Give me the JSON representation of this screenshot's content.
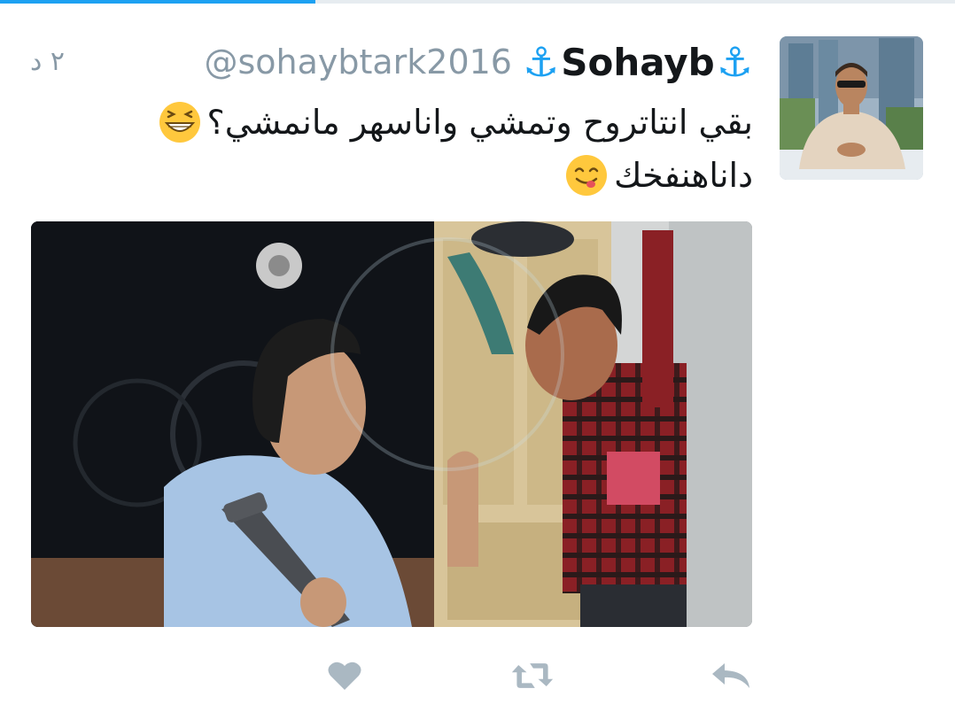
{
  "progress": {
    "fraction": 0.33,
    "color": "#1da1f2"
  },
  "tweet": {
    "timestamp": "٢ د",
    "display_name": "Sohayb",
    "handle": "@sohaybtark2016",
    "text_line_1": "بقي انتاتروح وتمشي واناسهر مانمشي؟",
    "text_line_2": "داناهنفخك"
  },
  "icons": {
    "name_prefix": "anchor-icon",
    "name_suffix": "anchor-icon",
    "emoji_1": "grinning-squinting-face-emoji",
    "emoji_2": "face-savoring-food-emoji",
    "like": "heart-icon",
    "retweet": "retweet-icon",
    "reply": "reply-icon"
  },
  "colors": {
    "accent": "#1da1f2",
    "secondary_text": "#8899a6",
    "action_icon": "#aab8c2"
  }
}
